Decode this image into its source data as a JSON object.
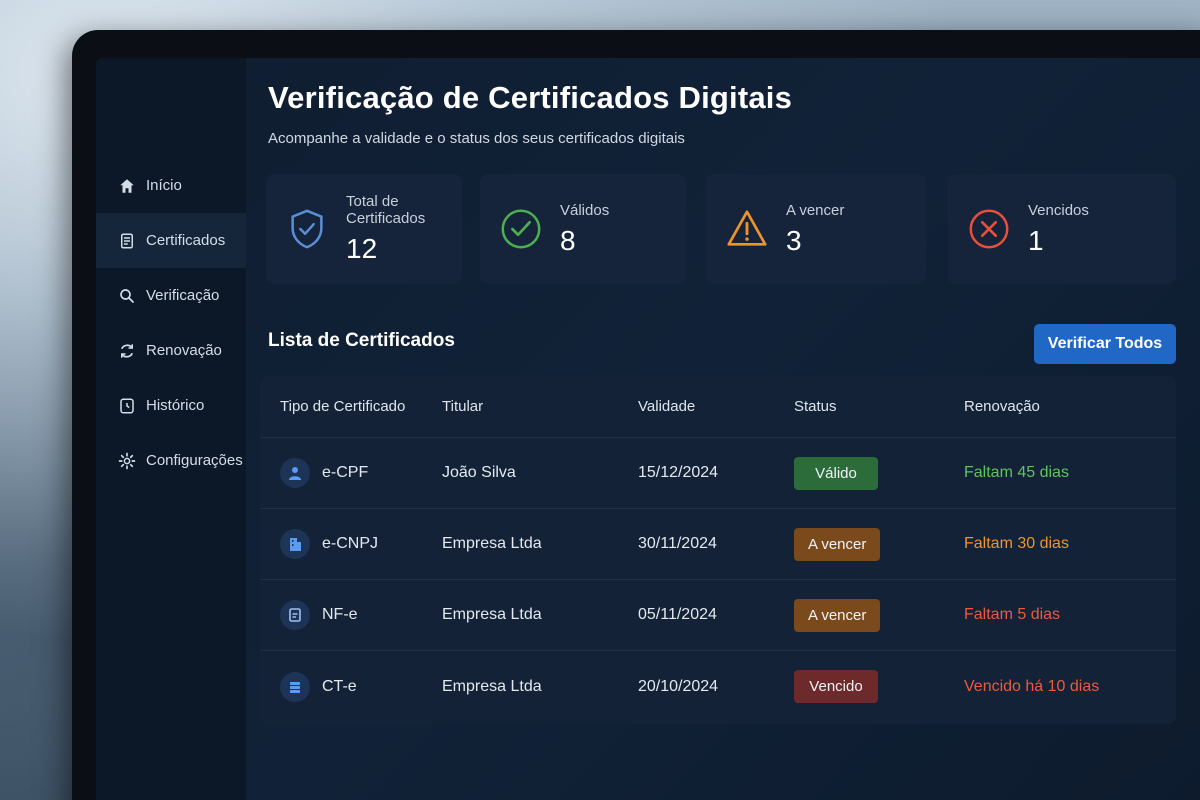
{
  "colors": {
    "accent": "#2167c5",
    "valid": "#4caf50",
    "warning": "#f0932b",
    "danger": "#e8503a",
    "badge_valid_bg": "#2c6b3a",
    "badge_warning_bg": "#7a4a1c",
    "badge_expired_bg": "#6e2a2a"
  },
  "sidebar": {
    "items": [
      {
        "label": "Início",
        "icon": "home-icon"
      },
      {
        "label": "Certificados",
        "icon": "document-icon"
      },
      {
        "label": "Verificação",
        "icon": "search-icon"
      },
      {
        "label": "Renovação",
        "icon": "refresh-icon"
      },
      {
        "label": "Histórico",
        "icon": "clock-icon"
      },
      {
        "label": "Configurações",
        "icon": "gear-icon"
      }
    ]
  },
  "header": {
    "title": "Verificação de Certificados Digitais",
    "subtitle": "Acompanhe a validade e o status dos seus certificados digitais"
  },
  "stats": [
    {
      "label": "Total de Certificados",
      "value": "12",
      "icon": "shield-check-icon"
    },
    {
      "label": "Válidos",
      "value": "8",
      "icon": "check-circle-icon"
    },
    {
      "label": "A vencer",
      "value": "3",
      "icon": "warning-triangle-icon"
    },
    {
      "label": "Vencidos",
      "value": "1",
      "icon": "x-circle-icon"
    }
  ],
  "list": {
    "title": "Lista de Certificados",
    "verify_all_label": "Verificar Todos",
    "columns": [
      "Tipo de Certificado",
      "Titular",
      "Validade",
      "Status",
      "Renovação"
    ],
    "rows": [
      {
        "type": "e-CPF",
        "icon": "user-icon",
        "holder": "João Silva",
        "validity": "15/12/2024",
        "status": "Válido",
        "renewal": "Faltam 45 dias"
      },
      {
        "type": "e-CNPJ",
        "icon": "building-icon",
        "holder": "Empresa Ltda",
        "validity": "30/11/2024",
        "status": "A vencer",
        "renewal": "Faltam 30 dias"
      },
      {
        "type": "NF-e",
        "icon": "invoice-icon",
        "holder": "Empresa Ltda",
        "validity": "05/11/2024",
        "status": "A vencer",
        "renewal": "Faltam 5 dias"
      },
      {
        "type": "CT-e",
        "icon": "server-icon",
        "holder": "Empresa Ltda",
        "validity": "20/10/2024",
        "status": "Vencido",
        "renewal": "Vencido há 10 dias"
      }
    ]
  }
}
